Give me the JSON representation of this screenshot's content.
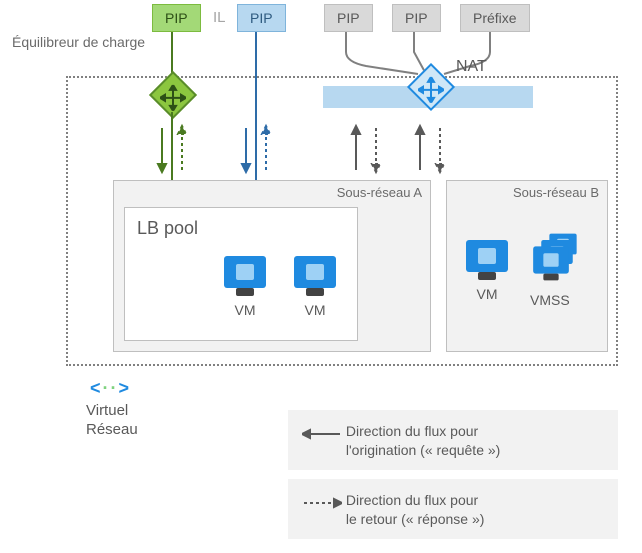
{
  "tags": {
    "pip_green": "PIP",
    "il": "IL",
    "pip_blue": "PIP",
    "pip_nat_1": "PIP",
    "pip_nat_2": "PIP",
    "prefix": "Préfixe"
  },
  "labels": {
    "load_balancer": "Équilibreur de charge",
    "nat": "NAT",
    "subnet_a": "Sous-réseau A",
    "subnet_b": "Sous-réseau B",
    "lb_pool": "LB pool",
    "vm": "VM",
    "vmss": "VMSS",
    "vnet_line1": "Virtuel",
    "vnet_line2": "Réseau"
  },
  "legend": {
    "request_line1": "Direction du flux pour",
    "request_line2": "l'origination (« requête »)",
    "response_line1": "Direction du flux pour",
    "response_line2": "le retour (« réponse »)"
  }
}
